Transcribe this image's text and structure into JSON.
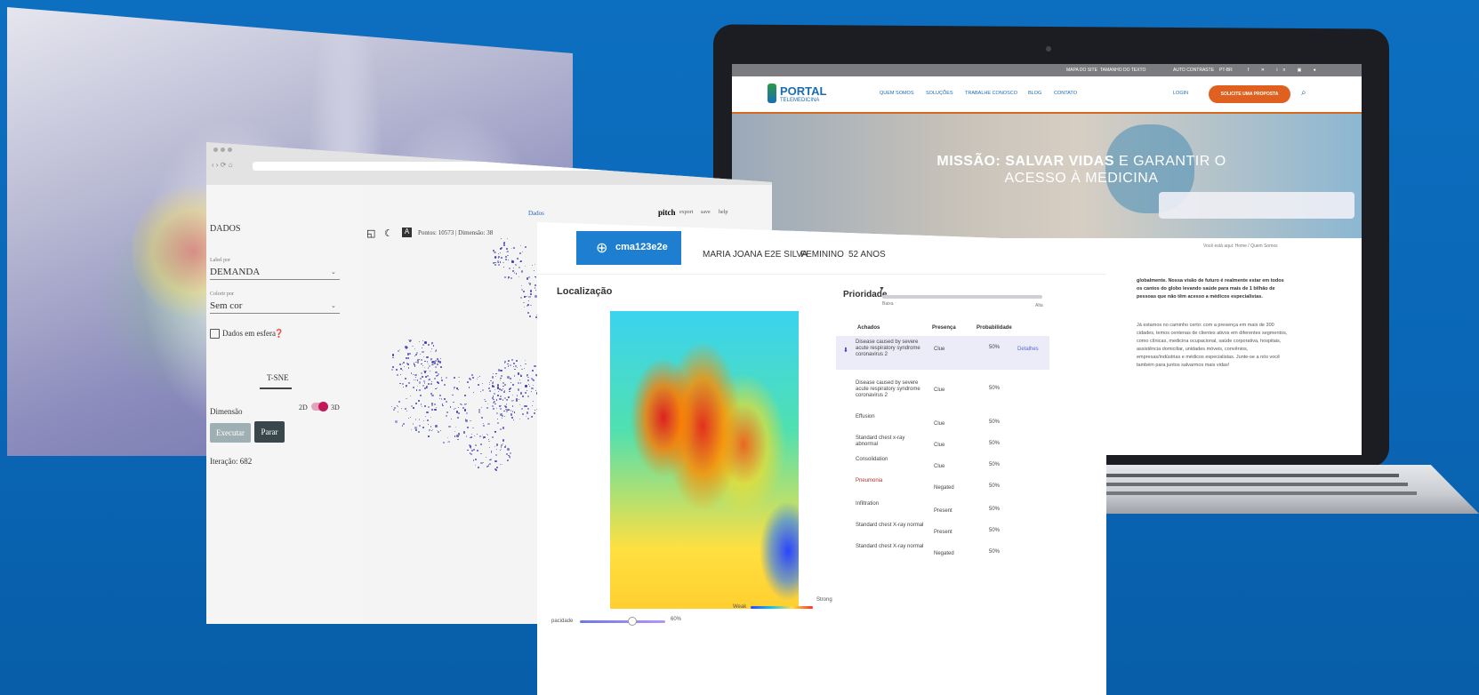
{
  "laptop_site": {
    "topbar": {
      "sitemap": "MAPA DO SITE",
      "text_size": "TAMANHO DO TEXTO",
      "contrast": "AUTO CONTRASTE",
      "language": "PT-BR"
    },
    "logo": {
      "line1": "PORTAL",
      "line2": "TELEMEDICINA"
    },
    "nav": [
      "QUEM SOMOS",
      "SOLUÇÕES",
      "TRABALHE CONOSCO",
      "BLOG",
      "CONTATO"
    ],
    "login": "LOGIN",
    "cta": "SOLICITE UMA PROPOSTA",
    "hero": {
      "bold": "MISSÃO: SALVAR VIDAS",
      "rest": "E GARANTIR O",
      "line2": "ACESSO À MEDICINA"
    },
    "breadcrumb": "Você está aqui: Home / Quem Somos",
    "body_bold": "globalmente. Nossa visão de futuro é realmente estar em todos os cantos do globo levando saúde para mais de 1 bilhão de pessoas que não têm acesso a médicos especialistas.",
    "body_text": "Já estamos no caminho certo: com a presença em mais de 300 cidades, temos centenas de clientes ativos em diferentes segmentos, como clínicas, medicina ocupacional, saúde corporativa, hospitais, assistência domiciliar, unidades móveis, convênios, empresas/indústrias e médicos especialistas. Junte-se a nós você também para juntos salvarmos mais vidas!"
  },
  "tsne_window": {
    "section": "DADOS",
    "label_by_caption": "Label por",
    "label_by_value": "DEMANDA",
    "color_by_caption": "Colorir por",
    "color_by_value": "Sem cor",
    "sphere_checkbox": "Dados em esfera",
    "tab": "T-SNE",
    "dimension_label": "Dimensão",
    "dim_2d": "2D",
    "dim_3d": "3D",
    "run_button": "Executar",
    "stop_button": "Parar",
    "iteration": "Iteração: 682",
    "plot_info": "Pontos: 10573 | Dimensão: 38",
    "header_right": [
      "pitch",
      "export",
      "save",
      "help"
    ],
    "header_link": "Dados"
  },
  "diagnosis_window": {
    "patient_id": "cma123e2e",
    "patient_name": "MARIA JOANA E2E SILVA",
    "sex": "FEMININO",
    "age": "52 ANOS",
    "localization_title": "Localização",
    "priority_title": "Prioridade",
    "priority_low": "Baixa",
    "priority_high": "Alta",
    "table_headers": [
      "Achados",
      "Presença",
      "Probabilidade"
    ],
    "rows": [
      {
        "finding": "Disease caused by severe acute respiratory syndrome coronavirus 2",
        "presence": "Clue",
        "probability": "50%",
        "extra": "Detalhes",
        "highlight": true
      },
      {
        "finding": "Disease caused by severe acute respiratory syndrome coronavirus 2",
        "presence": "Clue",
        "probability": "50%"
      },
      {
        "finding": "Effusion",
        "presence": "Clue",
        "probability": "50%"
      },
      {
        "finding": "Standard chest x-ray abnormal",
        "presence": "Clue",
        "probability": "50%"
      },
      {
        "finding": "Consolidation",
        "presence": "Clue",
        "probability": "50%"
      },
      {
        "finding": "Pneumonia",
        "presence": "Negated",
        "probability": "50%"
      },
      {
        "finding": "Infiltration",
        "presence": "Present",
        "probability": "50%"
      },
      {
        "finding": "Standard chest X-ray normal",
        "presence": "Present",
        "probability": "50%"
      },
      {
        "finding": "Standard chest X-ray normal",
        "presence": "Negated",
        "probability": "50%"
      }
    ],
    "opacity_label": "pacidade",
    "opacity_value": "60%",
    "scale_weak": "Weak",
    "scale_strong": "Strong"
  },
  "colors": {
    "background": "#0b69b8",
    "accent_blue": "#1e7fd0",
    "accent_orange": "#e0601f",
    "tsne_points": "#3a3bb0",
    "toggle": "#c2185b"
  }
}
